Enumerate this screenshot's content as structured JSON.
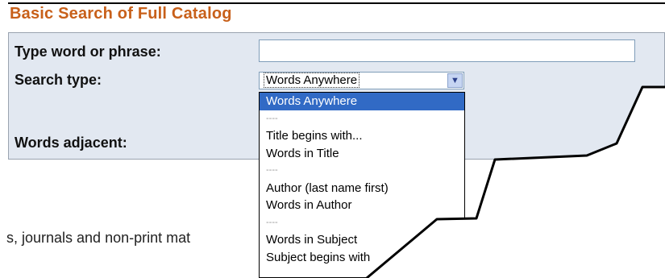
{
  "page": {
    "title": "Basic Search of Full Catalog",
    "footer_fragment": "s, journals and non-print mat"
  },
  "form": {
    "phrase_label": "Type word or phrase:",
    "phrase_value": "",
    "search_type_label": "Search type:",
    "search_type_selected": "Words Anywhere",
    "adjacent_label": "Words adjacent:"
  },
  "dropdown": {
    "options": [
      "Words Anywhere",
      "----",
      "Title begins with...",
      "Words in Title",
      "----",
      "Author (last name first)",
      "Words in Author",
      "----",
      "Words in Subject",
      "Subject begins with"
    ],
    "selected_index": 0
  },
  "colors": {
    "title": "#c8601a",
    "panel_bg": "#e2e8f1",
    "selection": "#316ac5"
  },
  "icons": {
    "select_arrow": "chevron-down-icon"
  }
}
